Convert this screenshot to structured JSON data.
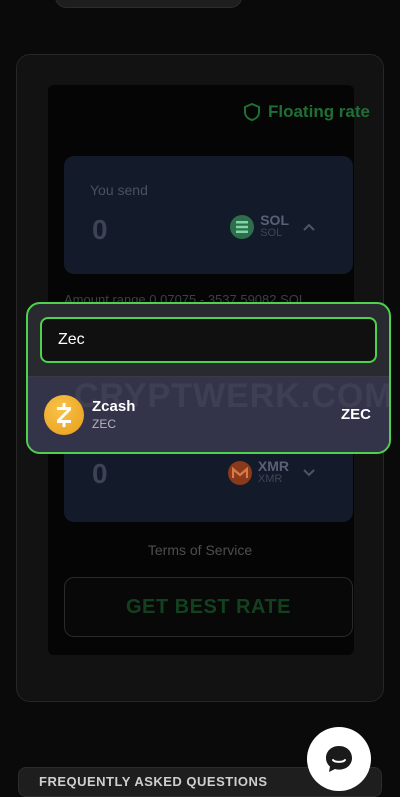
{
  "form": {
    "rate_type": "Floating rate",
    "send_label": "You send",
    "send_amount": "0",
    "send_coin": {
      "symbol": "SOL",
      "network": "SOL",
      "icon": "solana-icon"
    },
    "amount_range": "Amount range 0.07075 - 3537.59082 SOL",
    "receive_amount": "0",
    "receive_coin": {
      "symbol": "XMR",
      "network": "XMR",
      "icon": "monero-icon"
    },
    "terms_label": "Terms of Service",
    "submit_label": "GET BEST RATE"
  },
  "search_popup": {
    "query": "Zec",
    "watermark": "CRYPTWERK.COM",
    "results": [
      {
        "name": "Zcash",
        "ticker_sub": "ZEC",
        "symbol": "ZEC",
        "icon": "zcash-icon"
      }
    ]
  },
  "faq": {
    "title": "FREQUENTLY ASKED QUESTIONS"
  },
  "colors": {
    "accent": "#4ed24d",
    "popup_bg": "#292930",
    "field_bg": "#131a2a",
    "zcash": "#f4b62c"
  }
}
